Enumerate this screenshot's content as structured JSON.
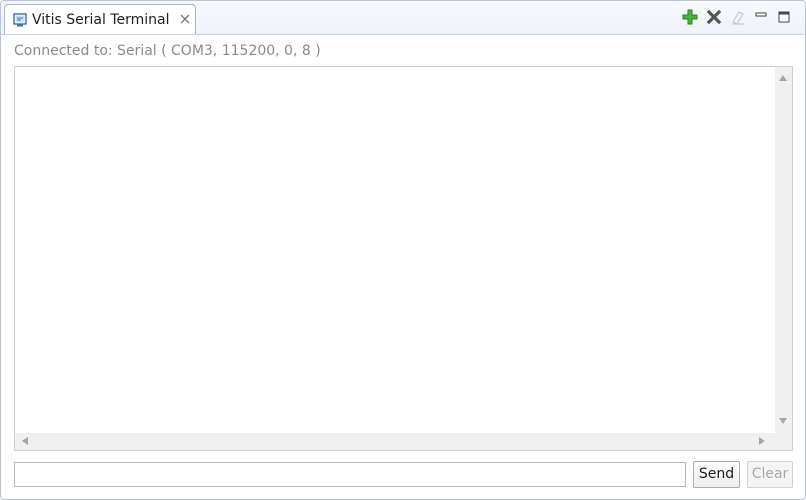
{
  "tab": {
    "title": "Vitis Serial Terminal",
    "icon": "terminal-icon",
    "close_icon": "close-tab-icon"
  },
  "toolbar": {
    "buttons": [
      {
        "name": "add-connection-button",
        "icon": "plus-icon",
        "color": "#3aa12f"
      },
      {
        "name": "disconnect-button",
        "icon": "x-icon",
        "color": "#555555"
      },
      {
        "name": "clear-console-button",
        "icon": "eraser-icon",
        "color": "#c9c9c9"
      },
      {
        "name": "minimize-button",
        "icon": "minimize-icon",
        "color": "#444444"
      },
      {
        "name": "maximize-button",
        "icon": "maximize-icon",
        "color": "#444444"
      }
    ]
  },
  "connection": {
    "status": "Connected to: Serial (  COM3, 115200, 0, 8 )"
  },
  "output": {
    "text": ""
  },
  "input": {
    "value": "",
    "placeholder": ""
  },
  "actions": {
    "send_label": "Send",
    "clear_label": "Clear"
  },
  "colors": {
    "border_accent": "#9fb5d1",
    "status_text": "#8a8a8a",
    "disabled_text": "#a8a8a8"
  }
}
